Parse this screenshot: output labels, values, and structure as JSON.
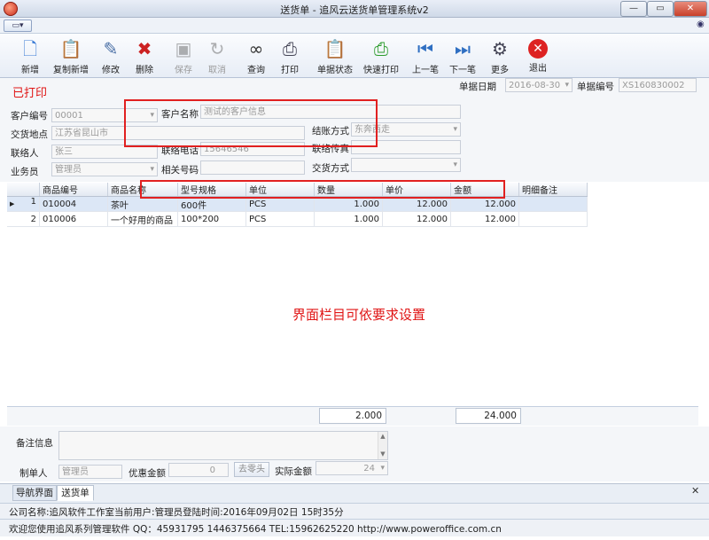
{
  "window": {
    "title": "送货单 - 追风云送货单管理系统v2",
    "min": "—",
    "max": "▭",
    "close": "✕"
  },
  "toolbar": [
    {
      "label": "新增",
      "icon": "new-icon"
    },
    {
      "label": "复制新增",
      "icon": "copy-icon"
    },
    {
      "label": "修改",
      "icon": "edit-icon"
    },
    {
      "label": "删除",
      "icon": "delete-icon"
    },
    {
      "label": "保存",
      "icon": "save-icon"
    },
    {
      "label": "取消",
      "icon": "cancel-icon"
    },
    {
      "label": "查询",
      "icon": "binoculars-icon"
    },
    {
      "label": "打印",
      "icon": "printer-icon"
    },
    {
      "label": "单据状态",
      "icon": "clipboard-icon"
    },
    {
      "label": "快速打印",
      "icon": "quick-print-icon"
    },
    {
      "label": "上一笔",
      "icon": "prev-icon"
    },
    {
      "label": "下一笔",
      "icon": "next-icon"
    },
    {
      "label": "更多",
      "icon": "more-icon"
    },
    {
      "label": "退出",
      "icon": "exit-icon"
    }
  ],
  "form": {
    "status": "已打印",
    "doc_date_label": "单据日期",
    "doc_date": "2016-08-30",
    "doc_no_label": "单据编号",
    "doc_no": "XS160830002",
    "customer_no_label": "客户编号",
    "customer_no": "00001",
    "customer_name_label": "客户名称",
    "customer_name": "测试的客户信息",
    "delivery_place_label": "交货地点",
    "delivery_place": "江苏省昆山市",
    "payment_label": "结账方式",
    "payment": "东奔西走",
    "contact_label": "联络人",
    "contact": "张三",
    "phone_label": "联络电话",
    "phone": "15646546",
    "fax_label": "联络传真",
    "fax": "",
    "salesman_label": "业务员",
    "salesman": "管理员",
    "ref_no_label": "相关号码",
    "ref_no": "",
    "delivery_method_label": "交货方式",
    "delivery_method": ""
  },
  "grid": {
    "columns": [
      "商品编号",
      "商品名称",
      "型号规格",
      "单位",
      "数量",
      "单价",
      "金额",
      "明细备注"
    ],
    "rows": [
      {
        "index": "1",
        "cells": [
          "010004",
          "茶叶",
          "600件",
          "PCS",
          "1.000",
          "12.000",
          "12.000",
          ""
        ]
      },
      {
        "index": "2",
        "cells": [
          "010006",
          "一个好用的商品",
          "100*200",
          "PCS",
          "1.000",
          "12.000",
          "12.000",
          ""
        ]
      }
    ],
    "total_qty": "2.000",
    "total_amount": "24.000"
  },
  "hint": "界面栏目可依要求设置",
  "bottom": {
    "memo_label": "备注信息",
    "maker_label": "制单人",
    "maker": "管理员",
    "discount_label": "优惠金额",
    "discount": "0",
    "round_button": "去零头",
    "actual_label": "实际金额",
    "actual": "24"
  },
  "tabs": [
    "导航界面",
    "送货单"
  ],
  "status_bar": {
    "line1": "公司名称:追风软件工作室当前用户:管理员登陆时间:2016年09月02日 15时35分",
    "line2": "欢迎您使用追风系列管理软件 QQ：45931795 1446375664 TEL:15962625220 http://www.poweroffice.com.cn"
  },
  "colors": {
    "accent": "#e01515",
    "selected_row": "#dce7f6"
  }
}
